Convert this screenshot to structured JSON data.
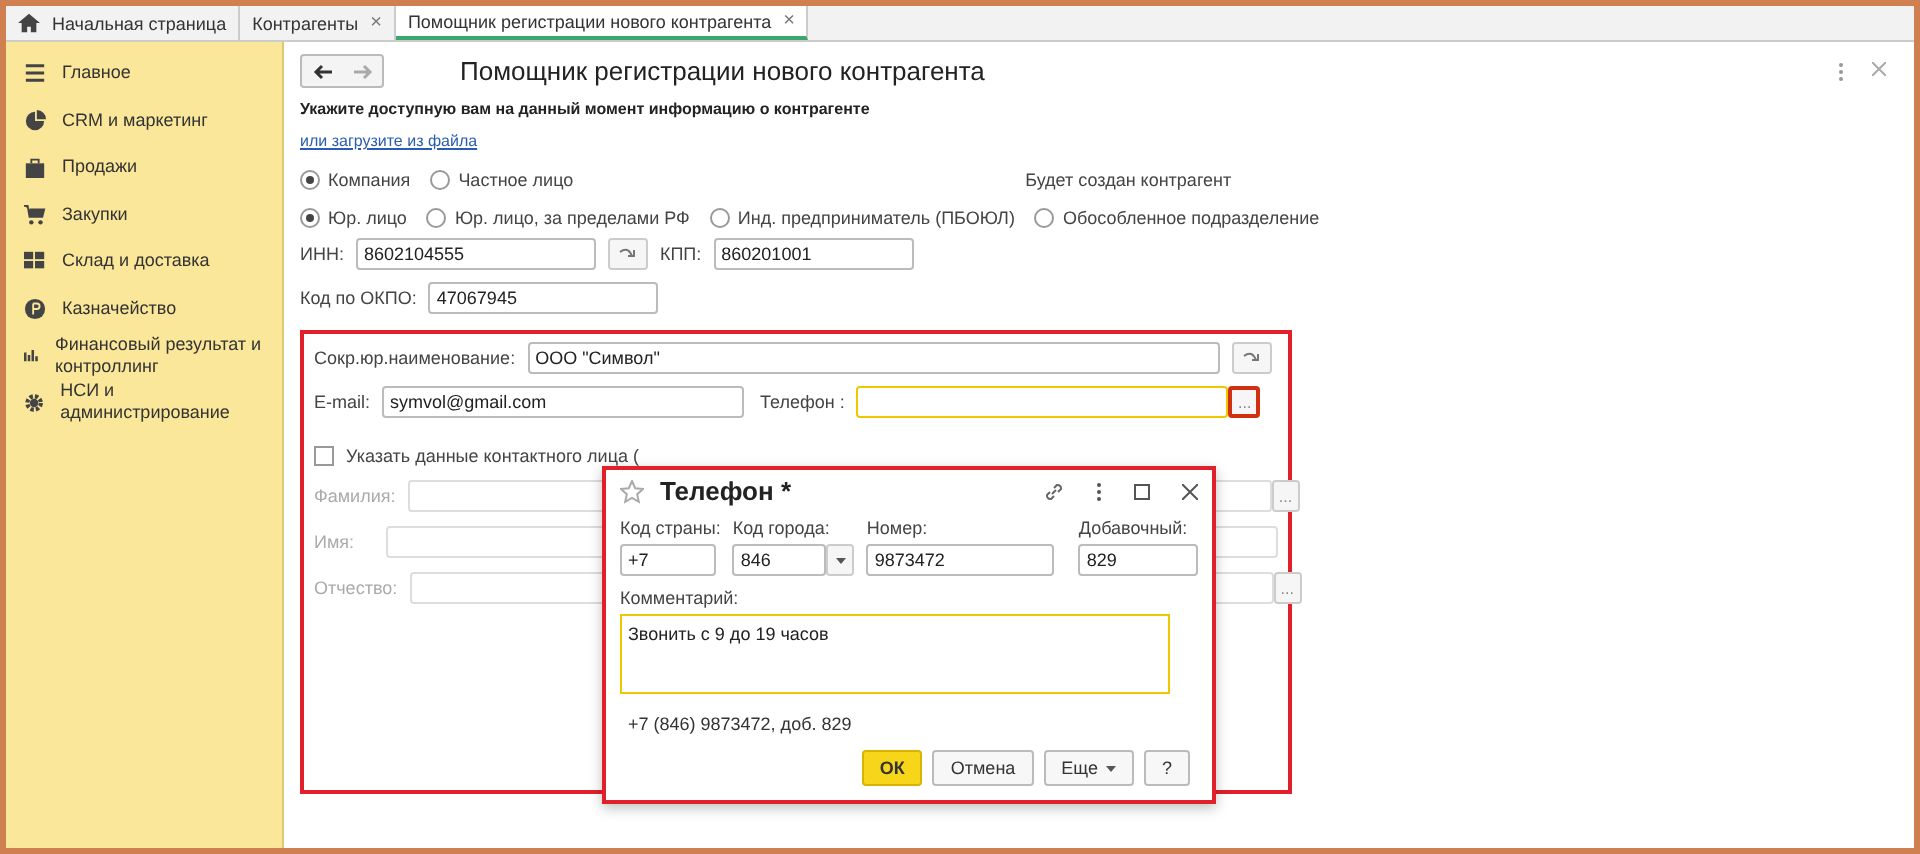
{
  "tabs": [
    {
      "label": "Начальная страница",
      "kind": "home",
      "selected": false
    },
    {
      "label": "Контрагенты",
      "kind": "page",
      "close": "×",
      "selected": false
    },
    {
      "label": "Помощник регистрации нового контрагента",
      "kind": "page",
      "close": "×",
      "selected": true
    }
  ],
  "sidebar": {
    "items": [
      {
        "label": "Главное"
      },
      {
        "label": "CRM и маркетинг"
      },
      {
        "label": "Продажи"
      },
      {
        "label": "Закупки"
      },
      {
        "label": "Склад и доставка"
      },
      {
        "label": "Казначейство"
      },
      {
        "label": "Финансовый результат и контроллинг"
      },
      {
        "label": "НСИ и администрирование"
      }
    ]
  },
  "form": {
    "title": "Помощник регистрации нового контрагента",
    "subtitle": "Укажите доступную вам на данный момент информацию о контрагенте",
    "link": "или загрузите из файла",
    "kind_options": [
      {
        "label": "Компания",
        "selected": true
      },
      {
        "label": "Частное лицо",
        "selected": false
      }
    ],
    "result_label": "Будет создан контрагент",
    "type_options": [
      {
        "label": "Юр. лицо",
        "selected": true
      },
      {
        "label": "Юр. лицо, за пределами РФ",
        "selected": false
      },
      {
        "label": "Инд. предприниматель (ПБОЮЛ)",
        "selected": false
      },
      {
        "label": "Обособленное подразделение",
        "selected": false
      }
    ],
    "inn": {
      "label": "ИНН:",
      "value": "8602104555"
    },
    "kpp": {
      "label": "КПП:",
      "value": "860201001"
    },
    "okpo": {
      "label": "Код по ОКПО:",
      "value": "47067945"
    },
    "short_name": {
      "label": "Сокр.юр.наименование:",
      "value": "ООО \"Символ\""
    },
    "email": {
      "label": "E-mail:",
      "value": "symvol@gmail.com"
    },
    "phone": {
      "label": "Телефон :",
      "button": "...",
      "focused": true
    },
    "contact_checkbox": {
      "label": "Указать данные контактного лица (",
      "checked": false
    },
    "contact_fields": [
      {
        "label": "Фамилия:",
        "button": "...",
        "disabled": true
      },
      {
        "label": "Имя:",
        "disabled": true
      },
      {
        "label": "Отчество:",
        "button": "...",
        "disabled": true
      }
    ]
  },
  "dialog": {
    "title": "Телефон *",
    "fields": [
      {
        "label": "Код страны:",
        "value": "+7",
        "kind": "text"
      },
      {
        "label": "Код города:",
        "value": "846",
        "kind": "dropdown"
      },
      {
        "label": "Номер:",
        "value": "9873472",
        "kind": "text"
      },
      {
        "label": "Добавочный:",
        "value": "829",
        "kind": "text"
      }
    ],
    "comment": {
      "label": "Комментарий:",
      "value": "Звонить с 9 до 19 часов"
    },
    "preview": "+7 (846) 9873472, доб. 829",
    "buttons": [
      {
        "label": "ОК",
        "kind": "primary"
      },
      {
        "label": "Отмена",
        "kind": "plain"
      },
      {
        "label": "Еще",
        "kind": "menu"
      },
      {
        "label": "?",
        "kind": "plain"
      }
    ]
  }
}
